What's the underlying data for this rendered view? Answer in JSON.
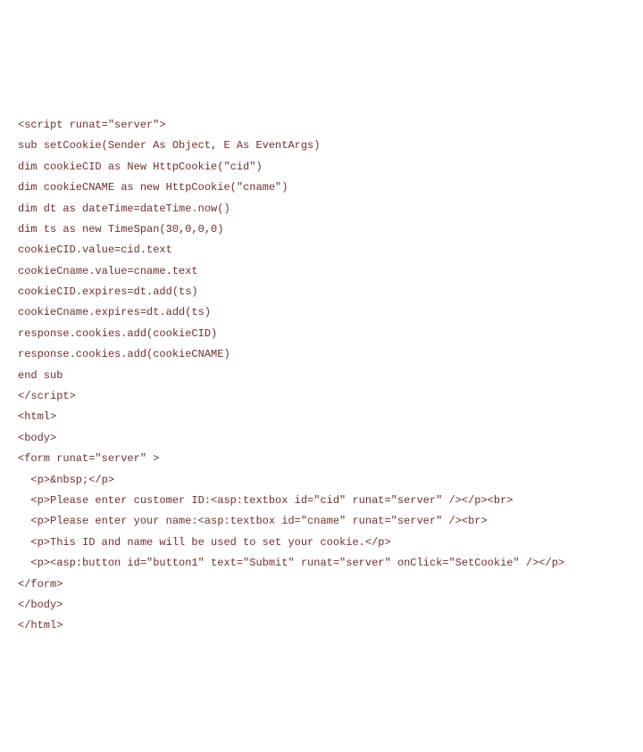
{
  "lines": [
    "<script runat=\"server\">",
    "sub setCookie(Sender As Object, E As EventArgs)",
    "dim cookieCID as New HttpCookie(\"cid\")",
    "dim cookieCNAME as new HttpCookie(\"cname\")",
    "dim dt as dateTime=dateTime.now()",
    "dim ts as new TimeSpan(30,0,0,0)",
    "cookieCID.value=cid.text",
    "cookieCname.value=cname.text",
    "cookieCID.expires=dt.add(ts)",
    "cookieCname.expires=dt.add(ts)",
    "response.cookies.add(cookieCID)",
    "response.cookies.add(cookieCNAME)",
    "end sub",
    "</script>",
    "<html>",
    "<body>",
    "<form runat=\"server\" >",
    "  <p>&nbsp;</p>",
    "  <p>Please enter customer ID:<asp:textbox id=\"cid\" runat=\"server\" /></p><br>",
    "  <p>Please enter your name:<asp:textbox id=\"cname\" runat=\"server\" /><br>",
    "  <p>This ID and name will be used to set your cookie.</p>",
    "  <p><asp:button id=\"button1\" text=\"Submit\" runat=\"server\" onClick=\"SetCookie\" /></p>",
    "</form>",
    "</body>",
    "</html>"
  ]
}
